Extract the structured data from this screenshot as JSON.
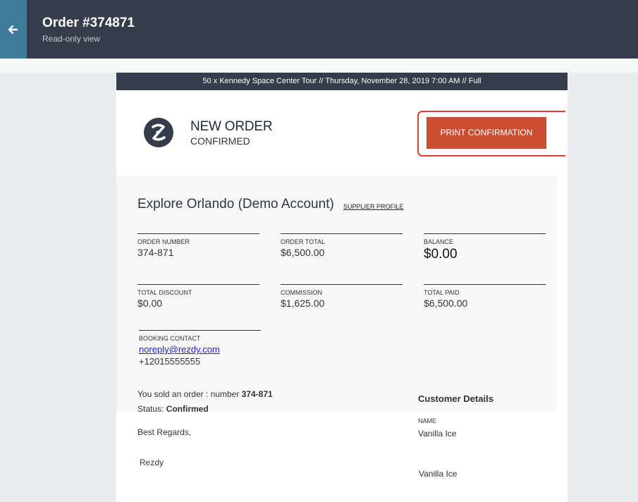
{
  "header": {
    "title": "Order #374871",
    "subtitle": "Read-only view"
  },
  "banner": {
    "text": "50 x Kennedy Space Center Tour // Thursday, November 28, 2019 7:00 AM // Full"
  },
  "status": {
    "heading": "NEW ORDER",
    "subheading": "CONFIRMED"
  },
  "print_button": {
    "label": "PRINT CONFIRMATION"
  },
  "supplier": {
    "name": "Explore Orlando (Demo Account)",
    "link_label": "SUPPLIER PROFILE"
  },
  "summary": {
    "order_number": {
      "label": "ORDER NUMBER",
      "value": "374-871"
    },
    "order_total": {
      "label": "ORDER TOTAL",
      "value": "$6,500.00"
    },
    "balance": {
      "label": "BALANCE",
      "value": "$0.00"
    },
    "total_discount": {
      "label": "TOTAL DISCOUNT",
      "value": "$0.00"
    },
    "commission": {
      "label": "COMMISSION",
      "value": "$1,625.00"
    },
    "total_paid": {
      "label": "TOTAL PAID",
      "value": "$6,500.00"
    }
  },
  "booking_contact": {
    "label": "BOOKING CONTACT",
    "email": "noreply@rezdy.com",
    "phone": "+12015555555"
  },
  "message": {
    "sold_prefix": "You sold an order : number ",
    "sold_number": "374-871",
    "status_prefix": "Status: ",
    "status_value": "Confirmed",
    "regards": "Best Regards,",
    "signoff": "Rezdy"
  },
  "customer": {
    "title": "Customer Details",
    "name_label": "NAME",
    "name": "Vanilla Ice",
    "name_repeat": "Vanilla Ice"
  },
  "colors": {
    "topbar": "#353d4b",
    "back_button": "#3e7b9a",
    "print_button": "#c94e32",
    "callout_border": "#e53935"
  }
}
